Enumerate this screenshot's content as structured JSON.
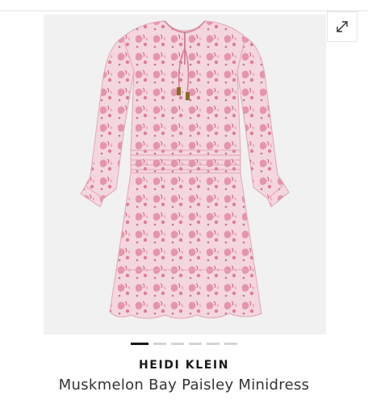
{
  "product": {
    "brand": "HEIDI KLEIN",
    "title": "Muskmelon Bay Paisley Minidress"
  },
  "gallery": {
    "image_count": 6,
    "active_index": 0,
    "expand_icon": "expand-diagonal-icon"
  },
  "colors": {
    "dress_base": "#f3d3dc",
    "dress_print": "#e27d98",
    "background": "#f1f1f1"
  }
}
